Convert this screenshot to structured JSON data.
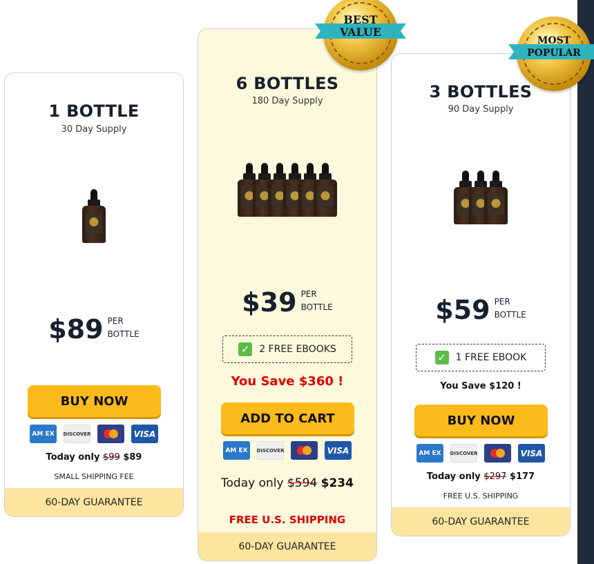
{
  "badges": {
    "best": "BEST VALUE",
    "best_line1": "BEST",
    "best_line2": "VALUE",
    "most_line1": "MOST",
    "most_line2": "POPULAR"
  },
  "cards": [
    {
      "title": "1 BOTTLE",
      "subtitle": "30 Day Supply",
      "price": "$89",
      "per_line1": "PER",
      "per_line2": "BOTTLE",
      "button": "BUY NOW",
      "today_label": "Today only",
      "old_price": "$99",
      "new_price": "$89",
      "shipping": "SMALL SHIPPING FEE",
      "guarantee": "60-DAY GUARANTEE"
    },
    {
      "title": "6 BOTTLES",
      "subtitle": "180 Day Supply",
      "price": "$39",
      "per_line1": "PER",
      "per_line2": "BOTTLE",
      "ebooks": "2 FREE EBOOKS",
      "you_save": "You Save $360 !",
      "button": "ADD TO CART",
      "today_label": "Today only",
      "old_price": "$594",
      "new_price": "$234",
      "shipping": "FREE U.S. SHIPPING",
      "guarantee": "60-DAY GUARANTEE"
    },
    {
      "title": "3 BOTTLES",
      "subtitle": "90 Day Supply",
      "price": "$59",
      "per_line1": "PER",
      "per_line2": "BOTTLE",
      "ebooks": "1 FREE EBOOK",
      "you_save": "You Save $120 !",
      "button": "BUY NOW",
      "today_label": "Today only",
      "old_price": "$297",
      "new_price": "$177",
      "shipping": "FREE U.S. SHIPPING",
      "guarantee": "60-DAY GUARANTEE"
    }
  ],
  "payment_cards": {
    "amex": "AM EX",
    "discover": "DISCOVER",
    "visa": "VISA"
  },
  "colors": {
    "button": "#fdbb1b",
    "highlight_bg": "#fcf9dc",
    "guarantee_bg": "#fde5a0",
    "save_red": "#e00000"
  },
  "icons": [
    "checkmark-icon",
    "amex-card-icon",
    "discover-card-icon",
    "mastercard-icon",
    "visa-card-icon"
  ]
}
